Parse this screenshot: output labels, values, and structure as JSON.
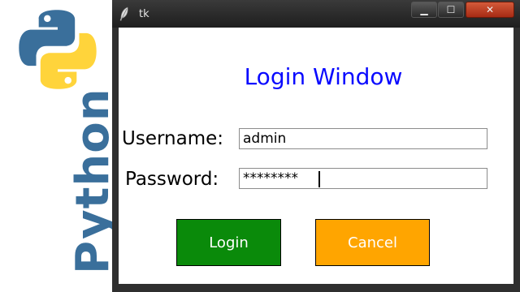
{
  "banner": {
    "logo_icon": "python-logo-icon",
    "word": "Python",
    "colors": {
      "blue": "#3a6f9b",
      "yellow": "#ffd43b"
    }
  },
  "window": {
    "title": "tk",
    "icon": "feather-icon",
    "controls": {
      "minimize": "▁",
      "maximize": "☐",
      "close": "✕"
    }
  },
  "form": {
    "heading": "Login Window",
    "username_label": "Username:",
    "username_value": "admin",
    "password_label": "Password:",
    "password_value": "********",
    "login_label": "Login",
    "cancel_label": "Cancel"
  },
  "colors": {
    "heading": "#0a0aff",
    "login_button": "#0a8a0a",
    "cancel_button": "#ffa500"
  }
}
